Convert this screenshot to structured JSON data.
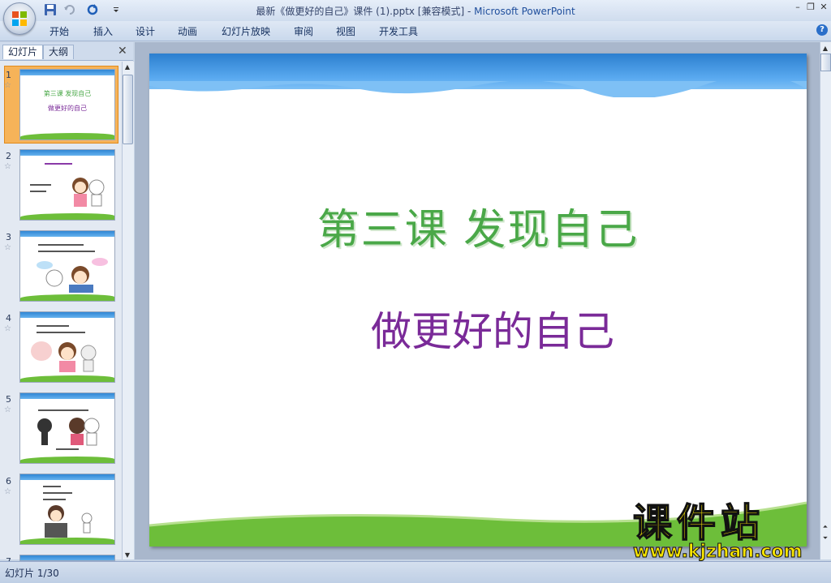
{
  "window": {
    "title_doc": "最新《做更好的自己》课件 (1).pptx [兼容模式] -",
    "title_app": "Microsoft PowerPoint",
    "buttons": {
      "minimize": "–",
      "restore": "❐",
      "close": "✕"
    }
  },
  "qat": {
    "save_icon": "save-icon",
    "undo_icon": "undo-icon",
    "redo_icon": "redo-icon",
    "customize_icon": "dropdown-icon"
  },
  "menu": [
    "开始",
    "插入",
    "设计",
    "动画",
    "幻灯片放映",
    "审阅",
    "视图",
    "开发工具"
  ],
  "help": "?",
  "pane": {
    "tabs": [
      "幻灯片",
      "大纲"
    ],
    "close": "✕",
    "thumbnails": [
      {
        "num": "1",
        "star": "☆",
        "line1": "第三课  发现自己",
        "line2": "做更好的自己"
      },
      {
        "num": "2",
        "star": "☆"
      },
      {
        "num": "3",
        "star": "☆"
      },
      {
        "num": "4",
        "star": "☆"
      },
      {
        "num": "5",
        "star": "☆"
      },
      {
        "num": "6",
        "star": "☆"
      },
      {
        "num": "7",
        "star": ""
      }
    ]
  },
  "slide": {
    "title": "第三课  发现自己",
    "subtitle": "做更好的自己",
    "colors": {
      "title": "#4aa848",
      "subtitle": "#7a2a98",
      "band": "#2c7fcf",
      "grass": "#6dbe3a"
    }
  },
  "watermark": {
    "logo": "课件站",
    "url": "www.kjzhan.com"
  },
  "status": {
    "slide_indicator": "幻灯片 1/30"
  }
}
